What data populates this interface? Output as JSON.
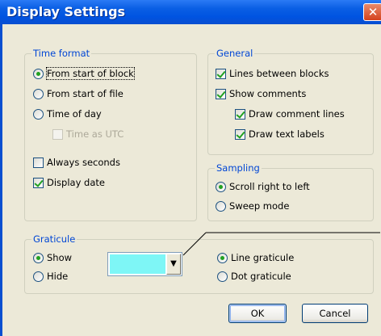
{
  "window": {
    "title": "Display Settings",
    "close_glyph": "✕"
  },
  "time_format": {
    "legend": "Time format",
    "from_start_of_block": "From start of block",
    "from_start_of_file": "From start of file",
    "time_of_day": "Time of day",
    "time_as_utc": "Time as UTC",
    "always_seconds": "Always seconds",
    "display_date": "Display date"
  },
  "general": {
    "legend": "General",
    "lines_between_blocks": "Lines between blocks",
    "show_comments": "Show comments",
    "draw_comment_lines": "Draw comment lines",
    "draw_text_labels": "Draw text labels"
  },
  "sampling": {
    "legend": "Sampling",
    "scroll_right_to_left": "Scroll right to left",
    "sweep_mode": "Sweep mode"
  },
  "graticule": {
    "legend": "Graticule",
    "show": "Show",
    "hide": "Hide",
    "color": "#7ef6f6",
    "dropdown_glyph": "▼",
    "line_graticule": "Line graticule",
    "dot_graticule": "Dot graticule"
  },
  "buttons": {
    "ok": "OK",
    "cancel": "Cancel"
  },
  "colors": {
    "titlebar": "#0053e1",
    "legend_text": "#0046d5",
    "checked_mark": "#21a121"
  }
}
